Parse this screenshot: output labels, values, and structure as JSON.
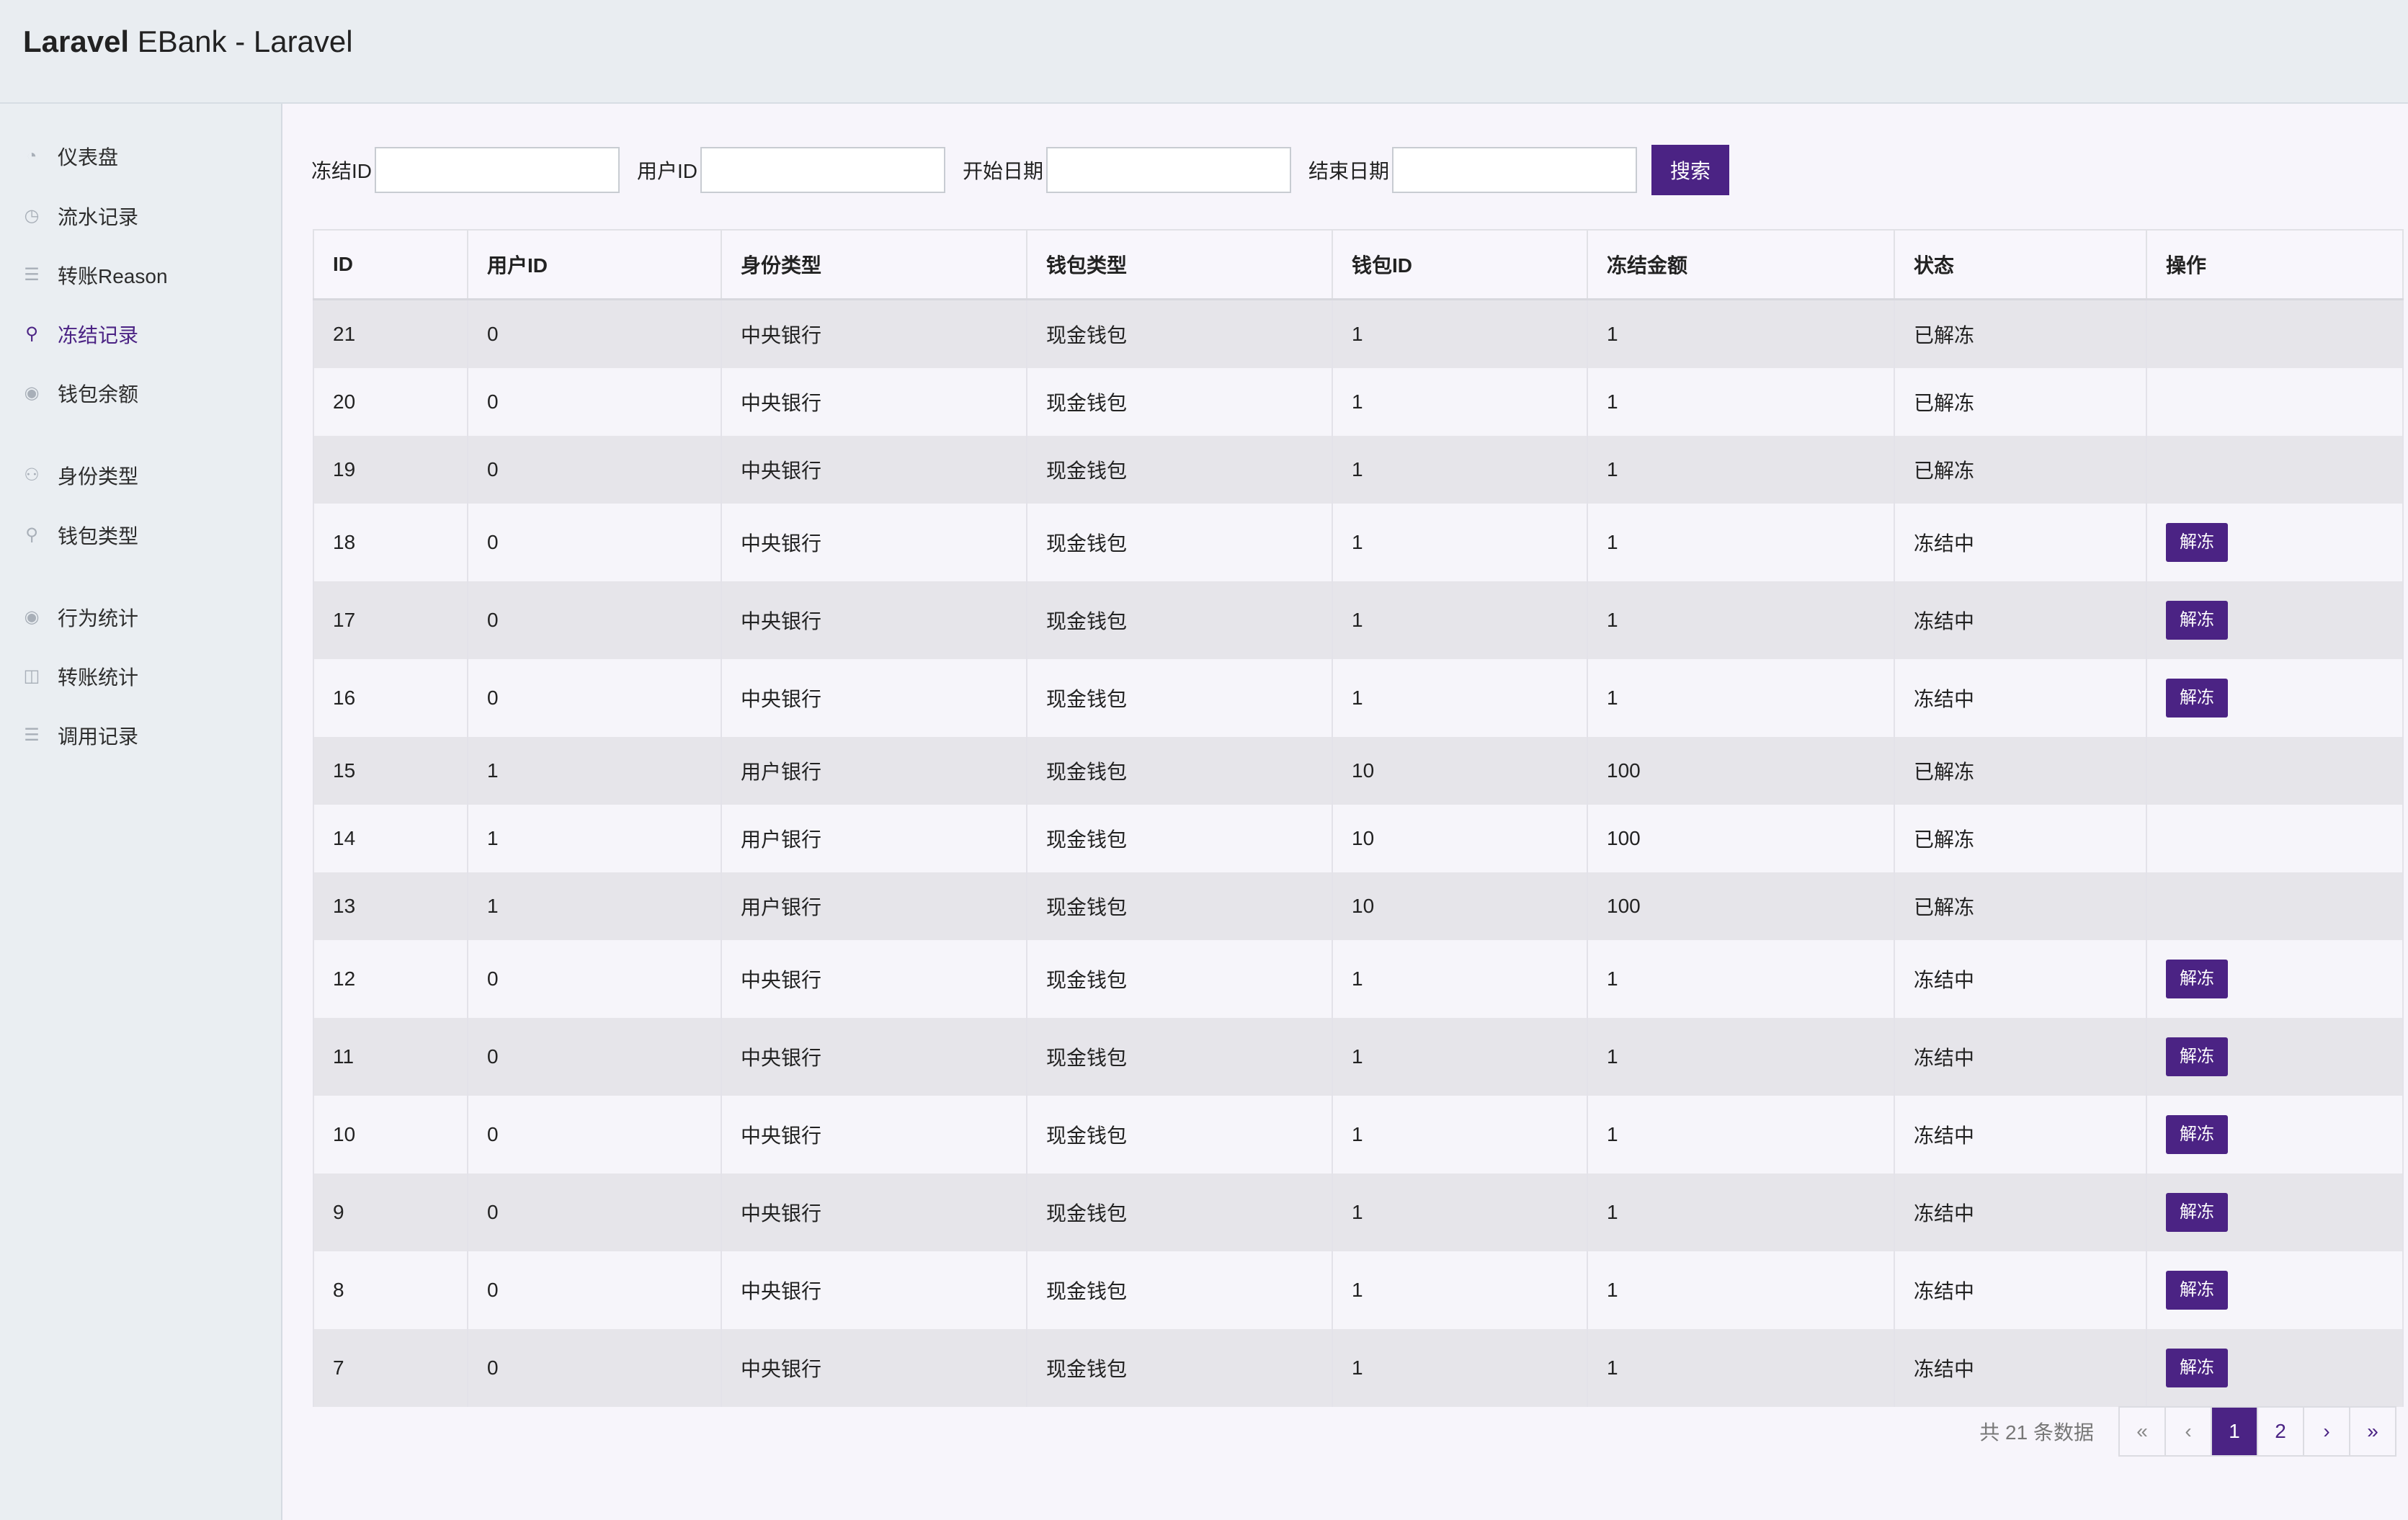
{
  "header": {
    "brand_bold": "Laravel",
    "brand_rest": " EBank - Laravel"
  },
  "sidebar": {
    "items": [
      {
        "label": "仪表盘",
        "icon": "dashboard-icon",
        "active": false
      },
      {
        "label": "流水记录",
        "icon": "history-icon",
        "active": false
      },
      {
        "label": "转账Reason",
        "icon": "list-icon",
        "active": false
      },
      {
        "label": "冻结记录",
        "icon": "link-icon",
        "active": true
      },
      {
        "label": "钱包余额",
        "icon": "coin-icon",
        "active": false
      },
      {
        "label": "身份类型",
        "icon": "users-icon",
        "active": false
      },
      {
        "label": "钱包类型",
        "icon": "user-icon",
        "active": false
      },
      {
        "label": "行为统计",
        "icon": "circle-dot-icon",
        "active": false
      },
      {
        "label": "转账统计",
        "icon": "search-doc-icon",
        "active": false
      },
      {
        "label": "调用记录",
        "icon": "doc-icon",
        "active": false
      }
    ]
  },
  "filters": {
    "freeze_id_label": "冻结ID",
    "user_id_label": "用户ID",
    "start_date_label": "开始日期",
    "end_date_label": "结束日期",
    "search_button": "搜索",
    "freeze_id_value": "",
    "user_id_value": "",
    "start_date_value": "",
    "end_date_value": ""
  },
  "table": {
    "columns": [
      "ID",
      "用户ID",
      "身份类型",
      "钱包类型",
      "钱包ID",
      "冻结金额",
      "状态",
      "操作"
    ],
    "action_label": "解冻",
    "rows": [
      {
        "id": "21",
        "user_id": "0",
        "identity": "中央银行",
        "wallet_type": "现金钱包",
        "wallet_id": "1",
        "amount": "1",
        "status": "已解冻",
        "released": true
      },
      {
        "id": "20",
        "user_id": "0",
        "identity": "中央银行",
        "wallet_type": "现金钱包",
        "wallet_id": "1",
        "amount": "1",
        "status": "已解冻",
        "released": true
      },
      {
        "id": "19",
        "user_id": "0",
        "identity": "中央银行",
        "wallet_type": "现金钱包",
        "wallet_id": "1",
        "amount": "1",
        "status": "已解冻",
        "released": true
      },
      {
        "id": "18",
        "user_id": "0",
        "identity": "中央银行",
        "wallet_type": "现金钱包",
        "wallet_id": "1",
        "amount": "1",
        "status": "冻结中",
        "released": false
      },
      {
        "id": "17",
        "user_id": "0",
        "identity": "中央银行",
        "wallet_type": "现金钱包",
        "wallet_id": "1",
        "amount": "1",
        "status": "冻结中",
        "released": false
      },
      {
        "id": "16",
        "user_id": "0",
        "identity": "中央银行",
        "wallet_type": "现金钱包",
        "wallet_id": "1",
        "amount": "1",
        "status": "冻结中",
        "released": false
      },
      {
        "id": "15",
        "user_id": "1",
        "identity": "用户银行",
        "wallet_type": "现金钱包",
        "wallet_id": "10",
        "amount": "100",
        "status": "已解冻",
        "released": true
      },
      {
        "id": "14",
        "user_id": "1",
        "identity": "用户银行",
        "wallet_type": "现金钱包",
        "wallet_id": "10",
        "amount": "100",
        "status": "已解冻",
        "released": true
      },
      {
        "id": "13",
        "user_id": "1",
        "identity": "用户银行",
        "wallet_type": "现金钱包",
        "wallet_id": "10",
        "amount": "100",
        "status": "已解冻",
        "released": true
      },
      {
        "id": "12",
        "user_id": "0",
        "identity": "中央银行",
        "wallet_type": "现金钱包",
        "wallet_id": "1",
        "amount": "1",
        "status": "冻结中",
        "released": false
      },
      {
        "id": "11",
        "user_id": "0",
        "identity": "中央银行",
        "wallet_type": "现金钱包",
        "wallet_id": "1",
        "amount": "1",
        "status": "冻结中",
        "released": false
      },
      {
        "id": "10",
        "user_id": "0",
        "identity": "中央银行",
        "wallet_type": "现金钱包",
        "wallet_id": "1",
        "amount": "1",
        "status": "冻结中",
        "released": false
      },
      {
        "id": "9",
        "user_id": "0",
        "identity": "中央银行",
        "wallet_type": "现金钱包",
        "wallet_id": "1",
        "amount": "1",
        "status": "冻结中",
        "released": false
      },
      {
        "id": "8",
        "user_id": "0",
        "identity": "中央银行",
        "wallet_type": "现金钱包",
        "wallet_id": "1",
        "amount": "1",
        "status": "冻结中",
        "released": false
      },
      {
        "id": "7",
        "user_id": "0",
        "identity": "中央银行",
        "wallet_type": "现金钱包",
        "wallet_id": "1",
        "amount": "1",
        "status": "冻结中",
        "released": false
      }
    ]
  },
  "footer": {
    "total_text": "共 21 条数据",
    "pager": [
      "«",
      "‹",
      "1",
      "2",
      "›",
      "»"
    ],
    "current_page": "1"
  },
  "colors": {
    "accent": "#4b2384",
    "released": "#28a745"
  }
}
